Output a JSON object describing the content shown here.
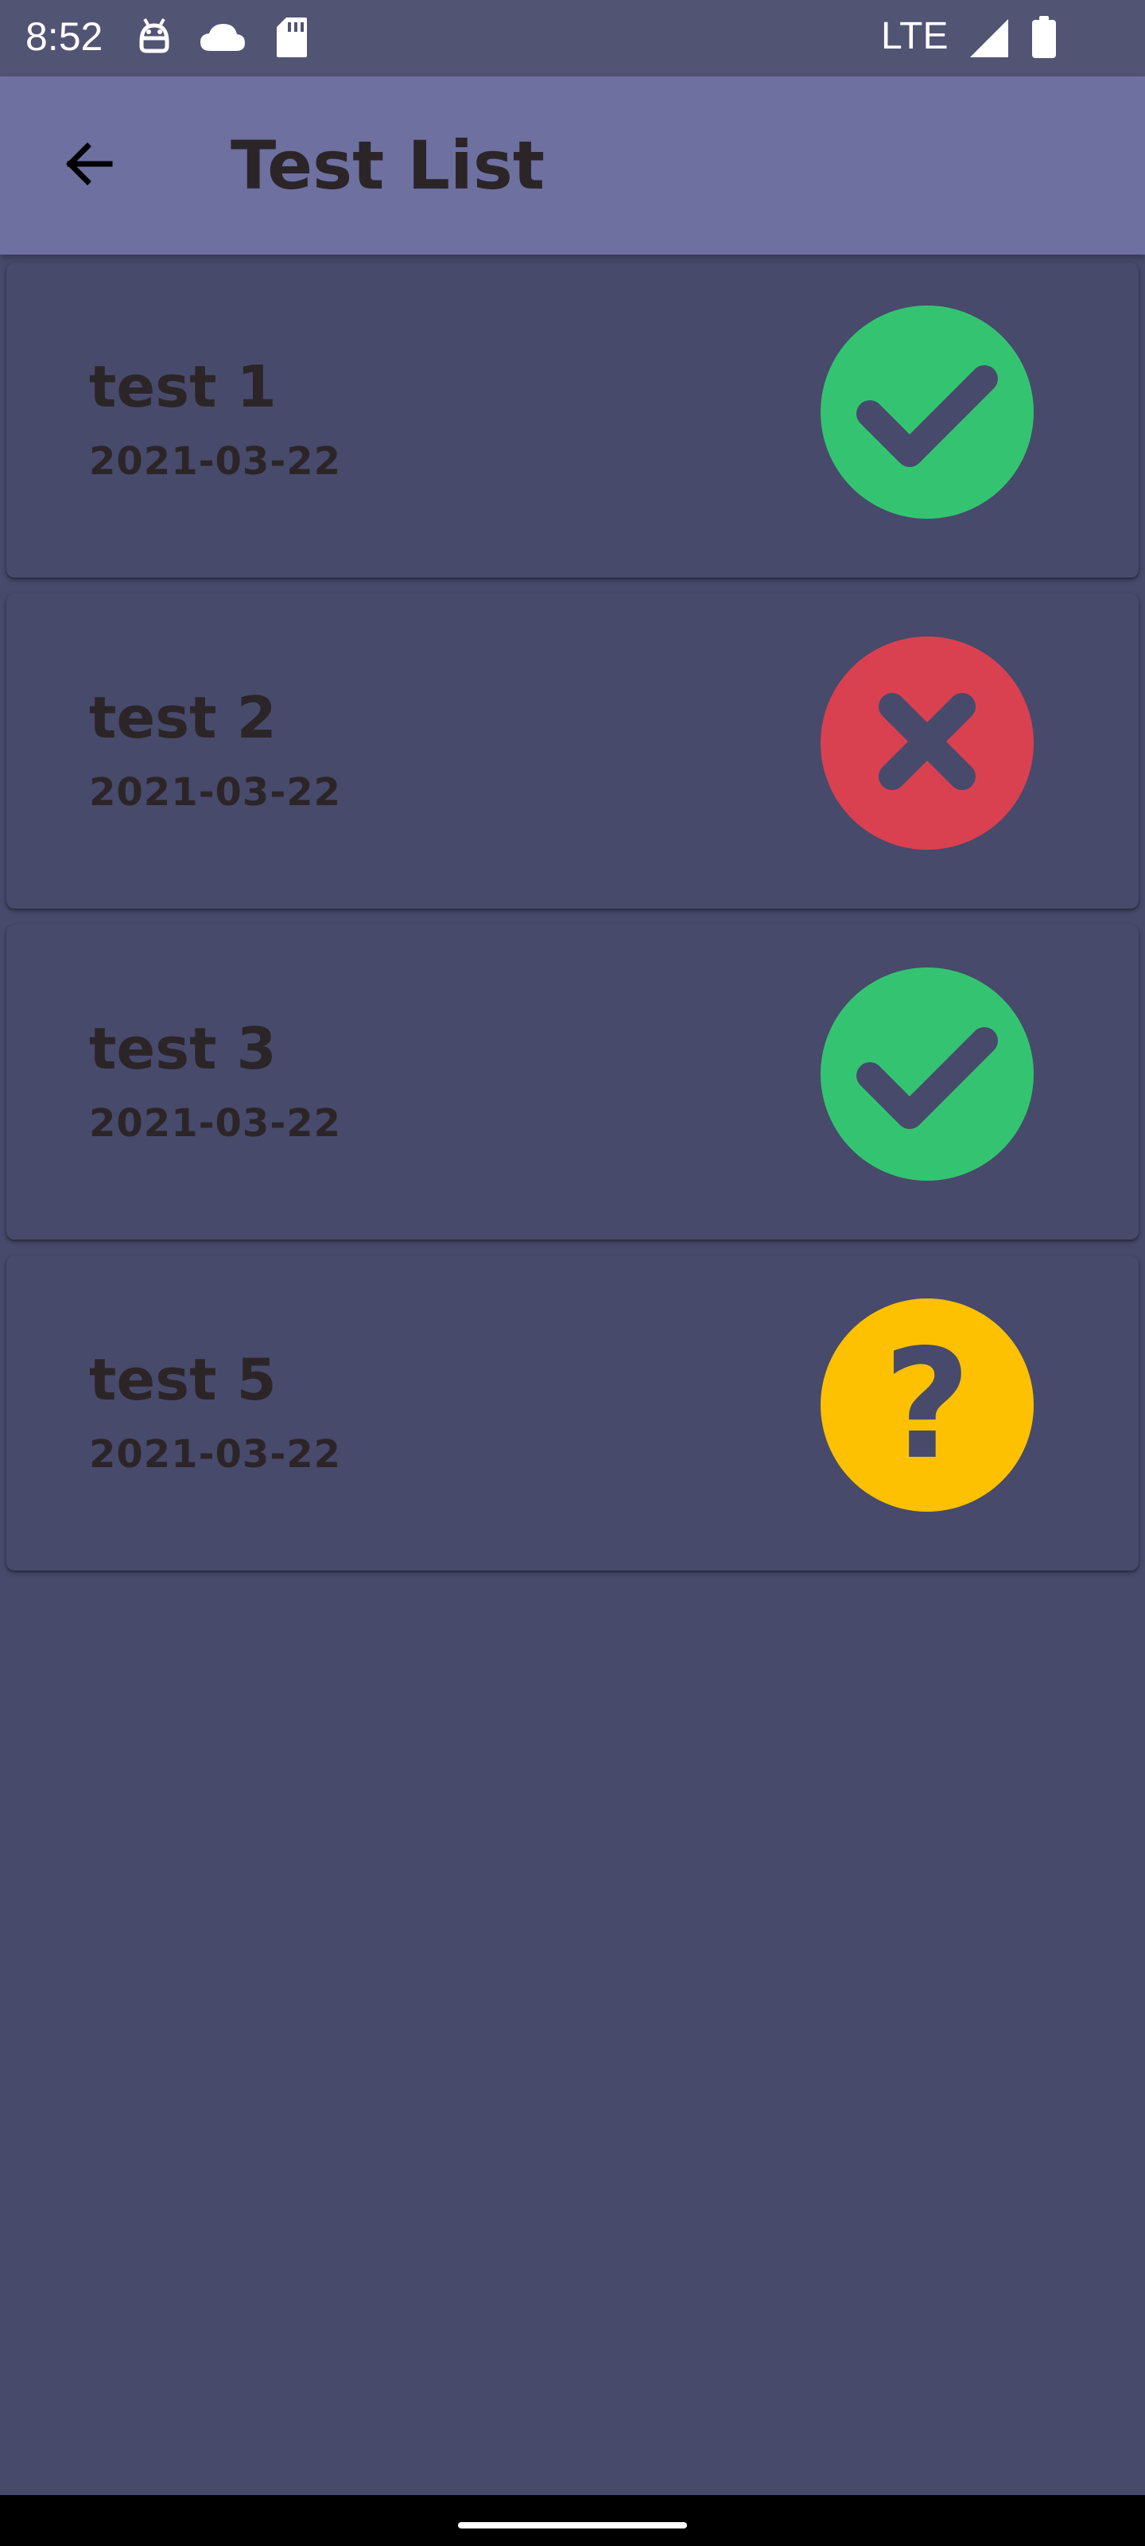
{
  "status_bar": {
    "time": "8:52",
    "network": "LTE",
    "icons": [
      "android-debug-icon",
      "cloud-icon",
      "sd-card-icon",
      "signal-icon",
      "battery-icon"
    ]
  },
  "app_bar": {
    "title": "Test List",
    "back_icon": "arrow-left-icon",
    "background": "#6e70a0"
  },
  "colors": {
    "background": "#474a6b",
    "text": "#2c2528",
    "pass": "#34c471",
    "fail": "#d94151",
    "unknown": "#fdc101"
  },
  "tests": [
    {
      "name": "test 1",
      "date": "2021-03-22",
      "status": "pass",
      "icon": "check-icon"
    },
    {
      "name": "test 2",
      "date": "2021-03-22",
      "status": "fail",
      "icon": "x-icon"
    },
    {
      "name": "test 3",
      "date": "2021-03-22",
      "status": "pass",
      "icon": "check-icon"
    },
    {
      "name": "test 5",
      "date": "2021-03-22",
      "status": "unknown",
      "icon": "question-icon",
      "symbol": "?"
    }
  ]
}
